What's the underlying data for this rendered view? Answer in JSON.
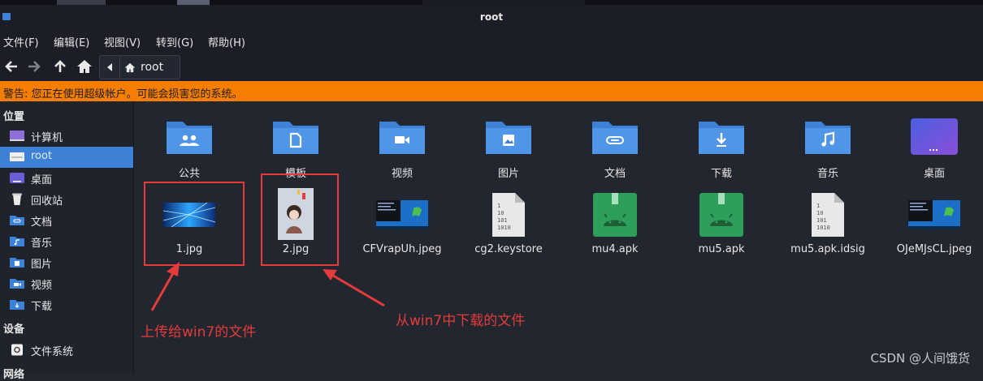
{
  "window": {
    "title": "root"
  },
  "menu": [
    "文件(F)",
    "编辑(E)",
    "视图(V)",
    "转到(G)",
    "帮助(H)"
  ],
  "breadcrumb": {
    "current": "root"
  },
  "warning": "警告: 您正在使用超级帐户。可能会损害您的系统。",
  "sidebar": {
    "places_header": "位置",
    "places": [
      {
        "label": "计算机",
        "icon": "computer-icon"
      },
      {
        "label": "root",
        "icon": "home-icon",
        "selected": true
      },
      {
        "label": "桌面",
        "icon": "desktop-icon"
      },
      {
        "label": "回收站",
        "icon": "trash-icon"
      },
      {
        "label": "文档",
        "icon": "documents-icon"
      },
      {
        "label": "音乐",
        "icon": "music-icon"
      },
      {
        "label": "图片",
        "icon": "pictures-icon"
      },
      {
        "label": "视频",
        "icon": "videos-icon"
      },
      {
        "label": "下载",
        "icon": "downloads-icon"
      }
    ],
    "devices_header": "设备",
    "devices": [
      {
        "label": "文件系统",
        "icon": "drive-icon"
      }
    ],
    "network_header": "网络"
  },
  "files": [
    {
      "name": "公共",
      "type": "folder",
      "emblem": "people-icon"
    },
    {
      "name": "模板",
      "type": "folder",
      "emblem": "template-icon"
    },
    {
      "name": "视频",
      "type": "folder",
      "emblem": "video-icon"
    },
    {
      "name": "图片",
      "type": "folder",
      "emblem": "picture-icon"
    },
    {
      "name": "文档",
      "type": "folder",
      "emblem": "link-icon"
    },
    {
      "name": "下载",
      "type": "folder",
      "emblem": "download-icon"
    },
    {
      "name": "音乐",
      "type": "folder",
      "emblem": "music-icon"
    },
    {
      "name": "桌面",
      "type": "folder-desktop",
      "emblem": "desktop-icon"
    },
    {
      "name": "1.jpg",
      "type": "image",
      "thumb": "tech-blue"
    },
    {
      "name": "2.jpg",
      "type": "image",
      "thumb": "portrait"
    },
    {
      "name": "CFVrapUh.jpeg",
      "type": "image",
      "thumb": "win7-screen"
    },
    {
      "name": "cg2.keystore",
      "type": "binary",
      "glyph": "1\n10\n101\n1010"
    },
    {
      "name": "mu4.apk",
      "type": "apk"
    },
    {
      "name": "mu5.apk",
      "type": "apk"
    },
    {
      "name": "mu5.apk.idsig",
      "type": "binary",
      "glyph": "1\n10\n101\n1010"
    },
    {
      "name": "OJeMJsCL.jpeg",
      "type": "image",
      "thumb": "win7-screen"
    }
  ],
  "annotations": {
    "left": "上传给win7的文件",
    "right": "从win7中下载的文件"
  },
  "watermark": "CSDN @人间饿货",
  "colors": {
    "accent": "#3d82d6",
    "warning": "#f57e00",
    "annotation": "#e53b3b",
    "apk": "#2e9e5b"
  }
}
